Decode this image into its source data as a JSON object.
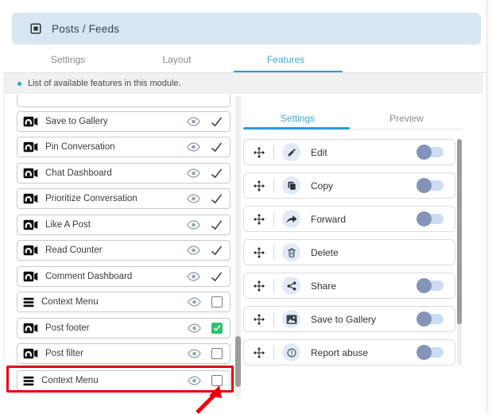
{
  "header": {
    "title": "Posts / Feeds"
  },
  "main_tabs": {
    "items": [
      {
        "label": "Settings",
        "active": false
      },
      {
        "label": "Layout",
        "active": false
      },
      {
        "label": "Features",
        "active": true
      }
    ]
  },
  "info_bar": {
    "text": "List of available features in this module."
  },
  "feature_list": {
    "items": [
      {
        "label": "Save to Gallery",
        "icon": "video-camera-icon",
        "state": "checked"
      },
      {
        "label": "Pin Conversation",
        "icon": "video-camera-icon",
        "state": "checked"
      },
      {
        "label": "Chat Dashboard",
        "icon": "video-camera-icon",
        "state": "checked"
      },
      {
        "label": "Prioritize Conversation",
        "icon": "video-camera-icon",
        "state": "checked"
      },
      {
        "label": "Like A Post",
        "icon": "video-camera-icon",
        "state": "checked"
      },
      {
        "label": "Read Counter",
        "icon": "video-camera-icon",
        "state": "checked"
      },
      {
        "label": "Comment Dashboard",
        "icon": "video-camera-icon",
        "state": "checked"
      },
      {
        "label": "Context Menu",
        "icon": "menu-icon",
        "state": "unchecked"
      },
      {
        "label": "Post footer",
        "icon": "video-camera-icon",
        "state": "checked-green"
      },
      {
        "label": "Post filter",
        "icon": "video-camera-icon",
        "state": "unchecked"
      },
      {
        "label": "Context Menu",
        "icon": "menu-icon",
        "state": "unchecked",
        "highlighted": true
      }
    ]
  },
  "detail_panel": {
    "tabs": [
      {
        "label": "Settings",
        "active": true
      },
      {
        "label": "Preview",
        "active": false
      }
    ],
    "rows": [
      {
        "label": "Edit",
        "icon": "pencil-icon",
        "has_toggle": true,
        "toggle_on": false
      },
      {
        "label": "Copy",
        "icon": "copy-icon",
        "has_toggle": true,
        "toggle_on": false
      },
      {
        "label": "Forward",
        "icon": "forward-icon",
        "has_toggle": true,
        "toggle_on": false
      },
      {
        "label": "Delete",
        "icon": "trash-icon",
        "has_toggle": false
      },
      {
        "label": "Share",
        "icon": "share-icon",
        "has_toggle": true,
        "toggle_on": false
      },
      {
        "label": "Save to Gallery",
        "icon": "gallery-icon",
        "has_toggle": true,
        "toggle_on": false
      },
      {
        "label": "Report abuse",
        "icon": "report-icon",
        "has_toggle": true,
        "toggle_on": false
      }
    ]
  },
  "annotation": {
    "type": "highlight-box-with-arrow",
    "target": "Context Menu",
    "color": "#e8000b"
  },
  "colors": {
    "header_bg": "#d8e6f3",
    "accent_blue": "#2a9cd6",
    "tab_active_text": "#45a7d9",
    "toggle_track": "#cdddf1",
    "toggle_knob": "#8494b8",
    "checkbox_green": "#2fc36d",
    "annotation_red": "#e8000b"
  }
}
